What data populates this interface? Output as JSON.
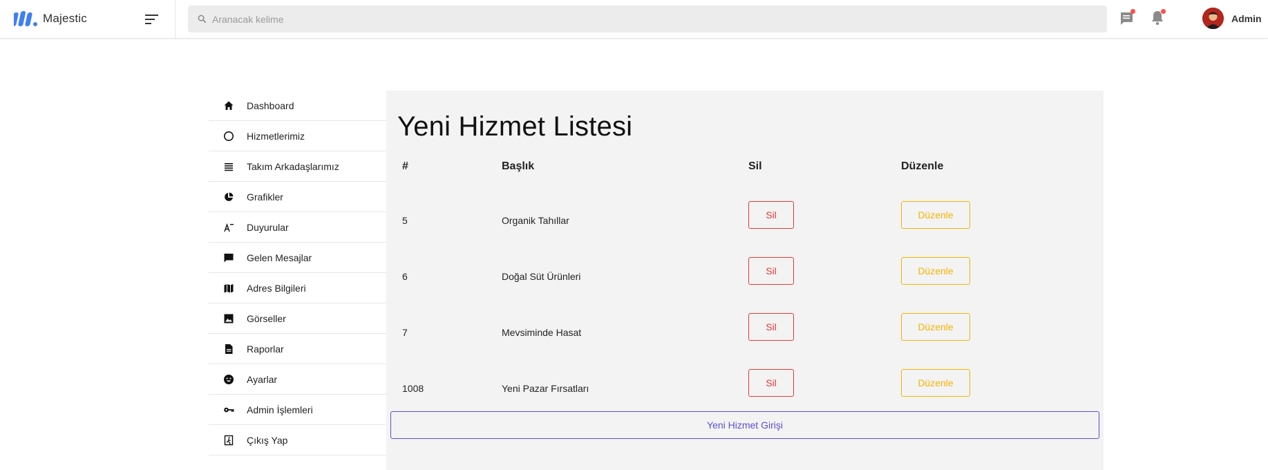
{
  "brand": {
    "name": "Majestic",
    "logo_icon": "majestic-logo-icon",
    "accent": "#3f7ef6"
  },
  "search": {
    "placeholder": "Aranacak kelime",
    "value": ""
  },
  "header": {
    "messages_icon": "message-icon",
    "notifications_icon": "bell-icon",
    "user_name": "Admin"
  },
  "sidebar": {
    "items": [
      {
        "label": "Dashboard",
        "icon": "home-icon"
      },
      {
        "label": "Hizmetlerimiz",
        "icon": "circle-icon"
      },
      {
        "label": "Takım Arkadaşlarımız",
        "icon": "list-icon"
      },
      {
        "label": "Grafikler",
        "icon": "pie-chart-icon"
      },
      {
        "label": "Duyurular",
        "icon": "text-size-icon"
      },
      {
        "label": "Gelen Mesajlar",
        "icon": "chat-icon"
      },
      {
        "label": "Adres Bilgileri",
        "icon": "map-icon"
      },
      {
        "label": "Görseller",
        "icon": "image-icon"
      },
      {
        "label": "Raporlar",
        "icon": "document-icon"
      },
      {
        "label": "Ayarlar",
        "icon": "smiley-icon"
      },
      {
        "label": "Admin İşlemleri",
        "icon": "key-icon"
      },
      {
        "label": "Çıkış Yap",
        "icon": "exit-icon"
      }
    ]
  },
  "main": {
    "title": "Yeni Hizmet Listesi",
    "columns": [
      "#",
      "Başlık",
      "Sil",
      "Düzenle"
    ],
    "rows": [
      {
        "id": "5",
        "title": "Organik Tahıllar",
        "delete_label": "Sil",
        "edit_label": "Düzenle"
      },
      {
        "id": "6",
        "title": "Doğal Süt Ürünleri",
        "delete_label": "Sil",
        "edit_label": "Düzenle"
      },
      {
        "id": "7",
        "title": "Mevsiminde Hasat",
        "delete_label": "Sil",
        "edit_label": "Düzenle"
      },
      {
        "id": "1008",
        "title": "Yeni Pazar Fırsatları",
        "delete_label": "Sil",
        "edit_label": "Düzenle"
      }
    ],
    "new_button_label": "Yeni Hizmet Girişi"
  },
  "colors": {
    "delete": "#e53935",
    "edit": "#f5b301",
    "new": "#5b4fcf",
    "badge": "#ff4d4d"
  }
}
